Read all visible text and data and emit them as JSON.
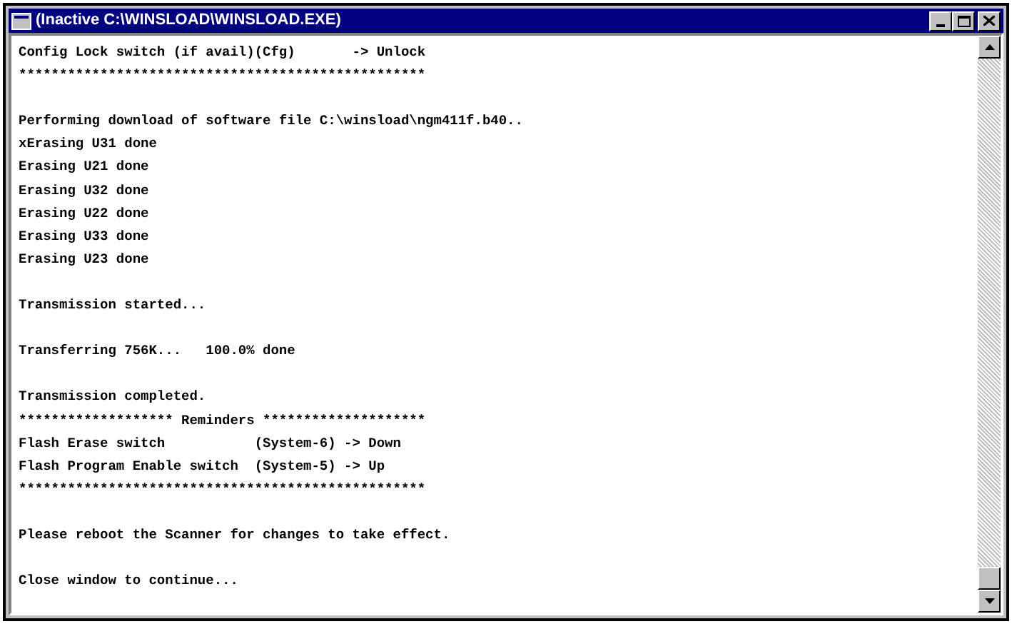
{
  "window": {
    "title": "(Inactive C:\\WINSLOAD\\WINSLOAD.EXE)"
  },
  "lines": [
    {
      "kind": "text",
      "text": "Config Lock switch (if avail)(Cfg)       -> Unlock"
    },
    {
      "kind": "text",
      "text": "**************************************************"
    },
    {
      "kind": "blank"
    },
    {
      "kind": "text",
      "text": "Performing download of software file C:\\winsload\\ngm411f.b40.."
    },
    {
      "kind": "text",
      "text": "xErasing U31 done"
    },
    {
      "kind": "text",
      "text": "Erasing U21 done"
    },
    {
      "kind": "text",
      "text": "Erasing U32 done"
    },
    {
      "kind": "text",
      "text": "Erasing U22 done"
    },
    {
      "kind": "text",
      "text": "Erasing U33 done"
    },
    {
      "kind": "text",
      "text": "Erasing U23 done"
    },
    {
      "kind": "blank"
    },
    {
      "kind": "text",
      "text": "Transmission started..."
    },
    {
      "kind": "blank"
    },
    {
      "kind": "text",
      "text": "Transferring 756K...   100.0% done"
    },
    {
      "kind": "blank"
    },
    {
      "kind": "text",
      "text": "Transmission completed."
    },
    {
      "kind": "text",
      "text": "******************* Reminders ********************"
    },
    {
      "kind": "text",
      "text": "Flash Erase switch           (System-6) -> Down"
    },
    {
      "kind": "text",
      "text": "Flash Program Enable switch  (System-5) -> Up"
    },
    {
      "kind": "text",
      "text": "**************************************************"
    },
    {
      "kind": "blank"
    },
    {
      "kind": "text",
      "text": "Please reboot the Scanner for changes to take effect."
    },
    {
      "kind": "blank"
    },
    {
      "kind": "text",
      "text": "Close window to continue..."
    }
  ]
}
